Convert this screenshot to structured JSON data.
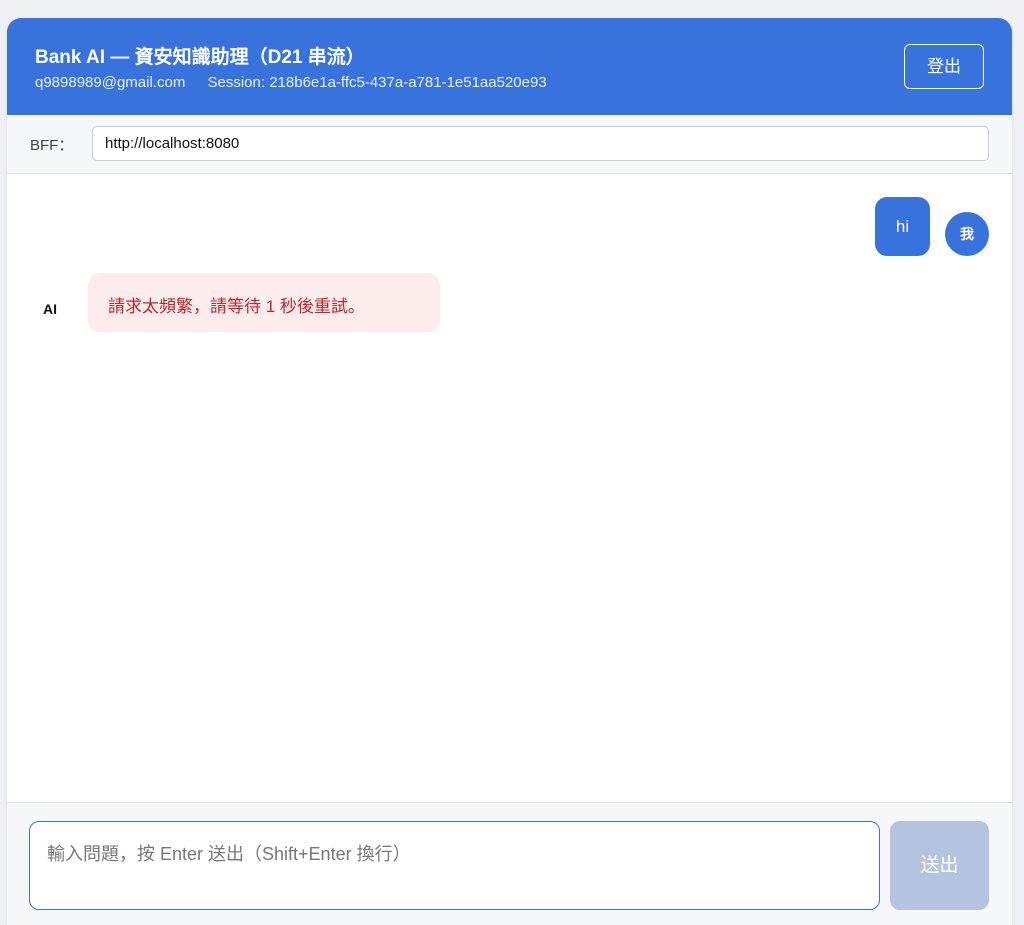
{
  "header": {
    "title": "Bank AI — 資安知識助理（D21 串流）",
    "email": "q9898989@gmail.com",
    "session": "Session: 218b6e1a-ffc5-437a-a781-1e51aa520e93",
    "logout_label": "登出"
  },
  "bff": {
    "label": "BFF：",
    "value": "http://localhost:8080"
  },
  "messages": [
    {
      "role": "user",
      "avatar": "我",
      "text": "hi"
    },
    {
      "role": "ai",
      "avatar": "AI",
      "text": "請求太頻繁，請等待 1 秒後重試。"
    }
  ],
  "composer": {
    "placeholder": "輸入問題，按 Enter 送出（Shift+Enter 換行）",
    "send_label": "送出"
  },
  "colors": {
    "accent": "#3873dd",
    "error_bg": "#fceceb",
    "error_text": "#c0262b",
    "send_disabled": "#b3c3e0"
  }
}
